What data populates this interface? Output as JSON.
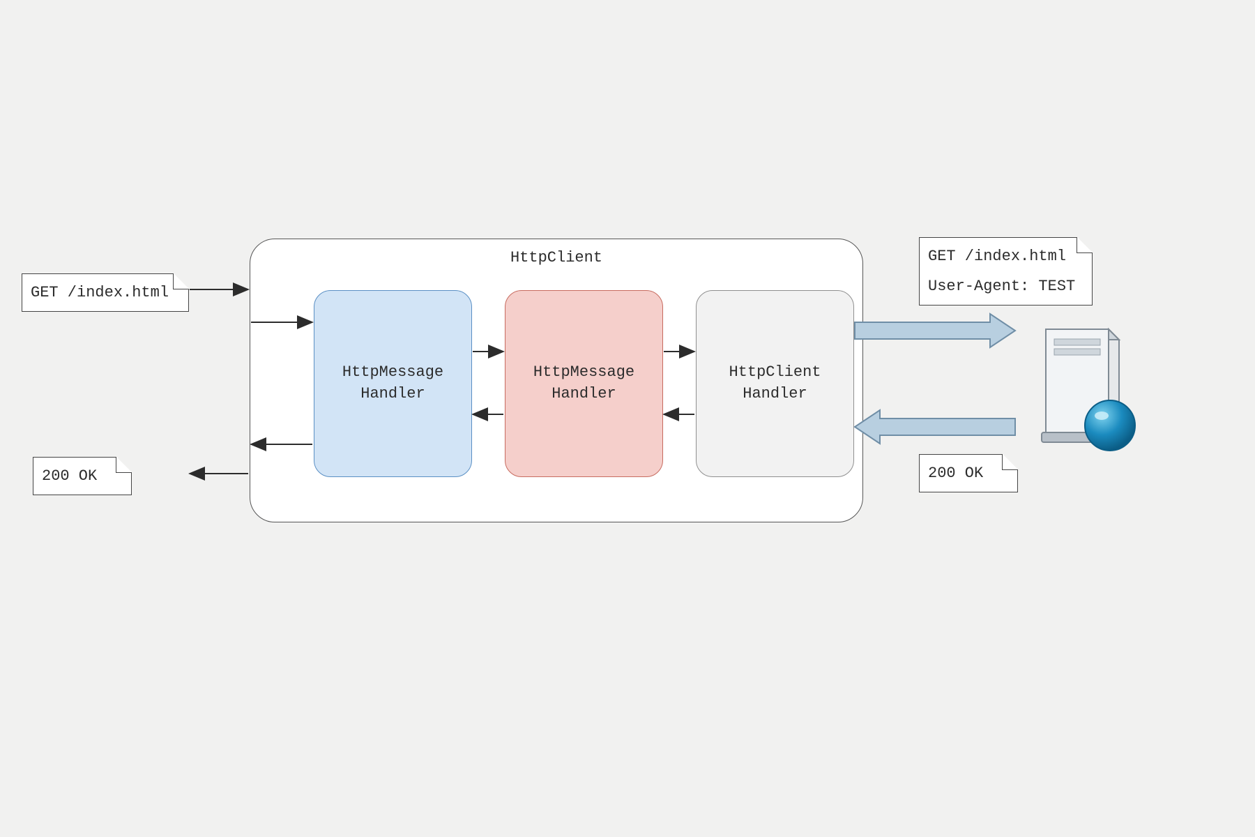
{
  "notes": {
    "request_in": "GET /index.html",
    "response_out": "200 OK",
    "request_wire_line1": "GET /index.html",
    "request_wire_line2": "User-Agent: TEST",
    "response_wire": "200 OK"
  },
  "container": {
    "title": "HttpClient"
  },
  "handlers": {
    "h1_line1": "HttpMessage",
    "h1_line2": "Handler",
    "h2_line1": "HttpMessage",
    "h2_line2": "Handler",
    "h3_line1": "HttpClient",
    "h3_line2": "Handler"
  },
  "colors": {
    "thin_arrow": "#2c2c2c",
    "block_arrow_fill": "#b8cfe0",
    "block_arrow_stroke": "#6f8ea6"
  }
}
